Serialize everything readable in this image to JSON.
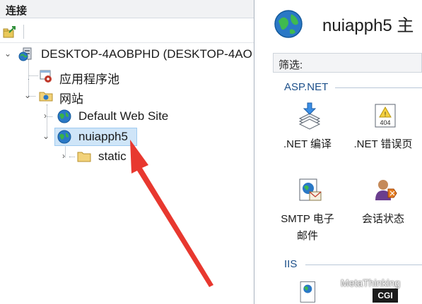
{
  "connections": {
    "title": "连接"
  },
  "tree": {
    "server": "DESKTOP-4AOBPHD (DESKTOP-4AO",
    "app_pools": "应用程序池",
    "sites": "网站",
    "default_site": "Default Web Site",
    "selected_site": "nuiapph5",
    "static_folder": "static"
  },
  "main": {
    "title": "nuiapph5 主",
    "filter_label": "筛选:",
    "groups": [
      {
        "name": "ASP.NET",
        "features": [
          {
            "label": ".NET 编译",
            "icon": "net-compilation-icon"
          },
          {
            "label": ".NET 错误页",
            "icon": "net-error-pages-icon"
          },
          {
            "label": "SMTP 电子邮件",
            "icon": "smtp-email-icon"
          },
          {
            "label": "会话状态",
            "icon": "session-state-icon"
          }
        ]
      },
      {
        "name": "IIS",
        "features": []
      }
    ]
  },
  "labels": {
    "smtp_line1": "SMTP 电子",
    "smtp_line2": "邮件"
  },
  "error_badge": "404",
  "watermark": {
    "text": "MetaThinking",
    "badge": "CGI"
  },
  "colors": {
    "selection": "#cfe5f8",
    "arrow": "#e8382f",
    "group_header": "#1c4f8a"
  }
}
